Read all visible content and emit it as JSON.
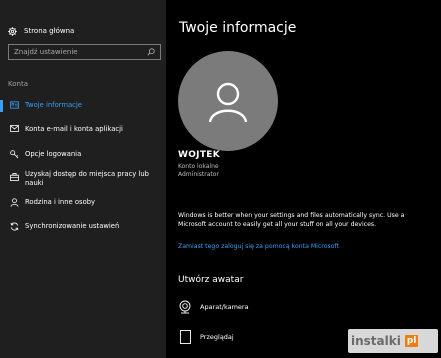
{
  "sidebar": {
    "home_label": "Strona główna",
    "search_placeholder": "Znajdź ustawienie",
    "section_label": "Konta",
    "items": [
      {
        "label": "Twoje informacje",
        "icon": "user-card-icon",
        "active": true
      },
      {
        "label": "Konta e-mail i konta aplikacji",
        "icon": "mail-icon"
      },
      {
        "label": "Opcje logowania",
        "icon": "key-icon"
      },
      {
        "label": "Uzyskaj dostęp do miejsca pracy lub nauki",
        "icon": "briefcase-icon"
      },
      {
        "label": "Rodzina i inne osoby",
        "icon": "person-icon"
      },
      {
        "label": "Synchronizowanie ustawień",
        "icon": "sync-icon"
      }
    ]
  },
  "main": {
    "title": "Twoje informacje",
    "user": {
      "name": "WOJTEK",
      "account_type": "Konto lokalne",
      "role": "Administrator"
    },
    "info_text": "Windows is better when your settings and files automatically sync. Use a Microsoft account to easily get all your stuff on all your devices.",
    "ms_link": "Zamiast tego zaloguj się za pomocą konta Microsoft",
    "avatar_heading": "Utwórz awatar",
    "avatar_options": [
      {
        "label": "Aparat/kamera",
        "icon": "camera-icon"
      },
      {
        "label": "Przeglądaj",
        "icon": "browse-icon"
      }
    ]
  },
  "watermark": {
    "text": "instalki",
    "badge": "pl"
  },
  "colors": {
    "accent": "#3a9ff5",
    "sidebar_bg": "#1f1f1f",
    "content_bg": "#000000",
    "avatar_bg": "#7b7b7b"
  }
}
